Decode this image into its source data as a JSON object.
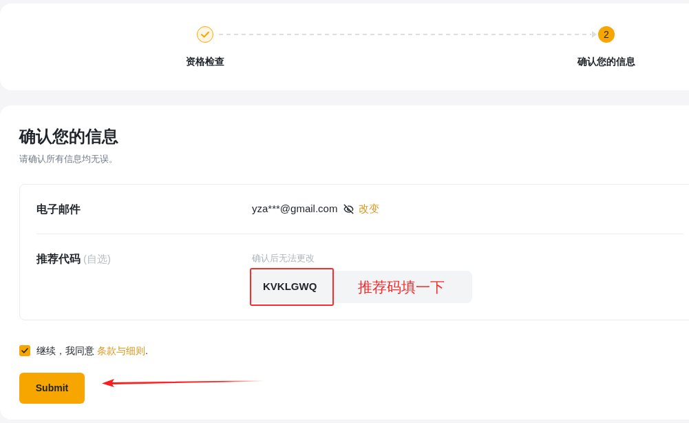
{
  "stepper": {
    "steps": [
      {
        "label": "资格检查",
        "completed": true
      },
      {
        "label": "确认您的信息",
        "completed": false,
        "number": "2"
      }
    ]
  },
  "form": {
    "title": "确认您的信息",
    "subtitle": "请确认所有信息均无误。",
    "fields": [
      {
        "kind": "email",
        "label": "电子邮件",
        "value": "yza***@gmail.com",
        "masked": true,
        "action": "改变"
      },
      {
        "kind": "referral",
        "label": "推荐代码",
        "optional_label": "(自选)",
        "hint": "确认后无法更改",
        "value": "KVKLGWQ",
        "annotation_box": true,
        "annotation_note": "推荐码填一下"
      }
    ],
    "agreement": {
      "checked": true,
      "text": "继续，我同意",
      "link": "条款与细则",
      "suffix": "."
    },
    "submit": {
      "label": "Submit",
      "annotation_arrow": true
    }
  }
}
